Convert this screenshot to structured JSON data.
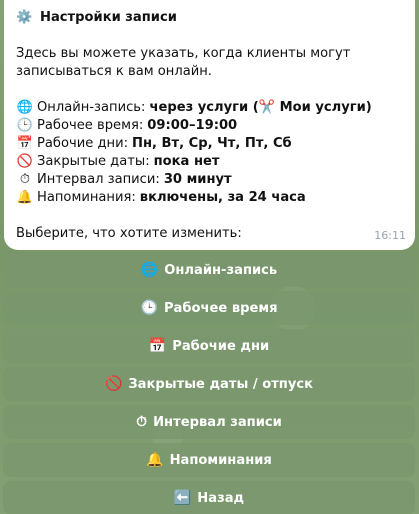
{
  "message": {
    "title_icon": "gear-icon",
    "title": "Настройки записи",
    "intro": "Здесь вы можете указать, когда клиенты могут записываться к вам онлайн.",
    "settings": [
      {
        "icon": "🌐",
        "icon_name": "globe-icon",
        "label": "Онлайн-запись:",
        "value": "через услуги (✂️ Мои услуги)"
      },
      {
        "icon": "🕒",
        "icon_name": "clock-icon",
        "label": "Рабочее время:",
        "value": "09:00–19:00"
      },
      {
        "icon": "📅",
        "icon_name": "calendar-icon",
        "label": "Рабочие дни:",
        "value": "Пн, Вт, Ср, Чт, Пт, Сб"
      },
      {
        "icon": "🚫",
        "icon_name": "no-entry-icon",
        "label": "Закрытые даты:",
        "value": "пока нет"
      },
      {
        "icon": "⏱",
        "icon_name": "stopwatch-icon",
        "label": "Интервал записи:",
        "value": "30 минут"
      },
      {
        "icon": "🔔",
        "icon_name": "bell-icon",
        "label": "Напоминания:",
        "value": "включены, за 24 часа"
      }
    ],
    "prompt": "Выберите, что хотите изменить:",
    "time": "16:11"
  },
  "keyboard": [
    {
      "icon": "🌐",
      "icon_name": "globe-icon",
      "label": "Онлайн-запись"
    },
    {
      "icon": "🕒",
      "icon_name": "clock-icon",
      "label": "Рабочее время"
    },
    {
      "icon": "📅",
      "icon_name": "calendar-icon",
      "label": "Рабочие дни"
    },
    {
      "icon": "🚫",
      "icon_name": "no-entry-icon",
      "label": "Закрытые даты / отпуск"
    },
    {
      "icon": "⏱",
      "icon_name": "stopwatch-icon",
      "label": "Интервал записи"
    },
    {
      "icon": "🔔",
      "icon_name": "bell-icon",
      "label": "Напоминания"
    },
    {
      "icon": "⬅️",
      "icon_name": "back-arrow-icon",
      "label": "Назад"
    }
  ],
  "colors": {
    "bubble": "#ffffff",
    "button_bg": "#7896 6e",
    "chat_bg": "#7e9b6e",
    "time_text": "#9aa4ad"
  }
}
